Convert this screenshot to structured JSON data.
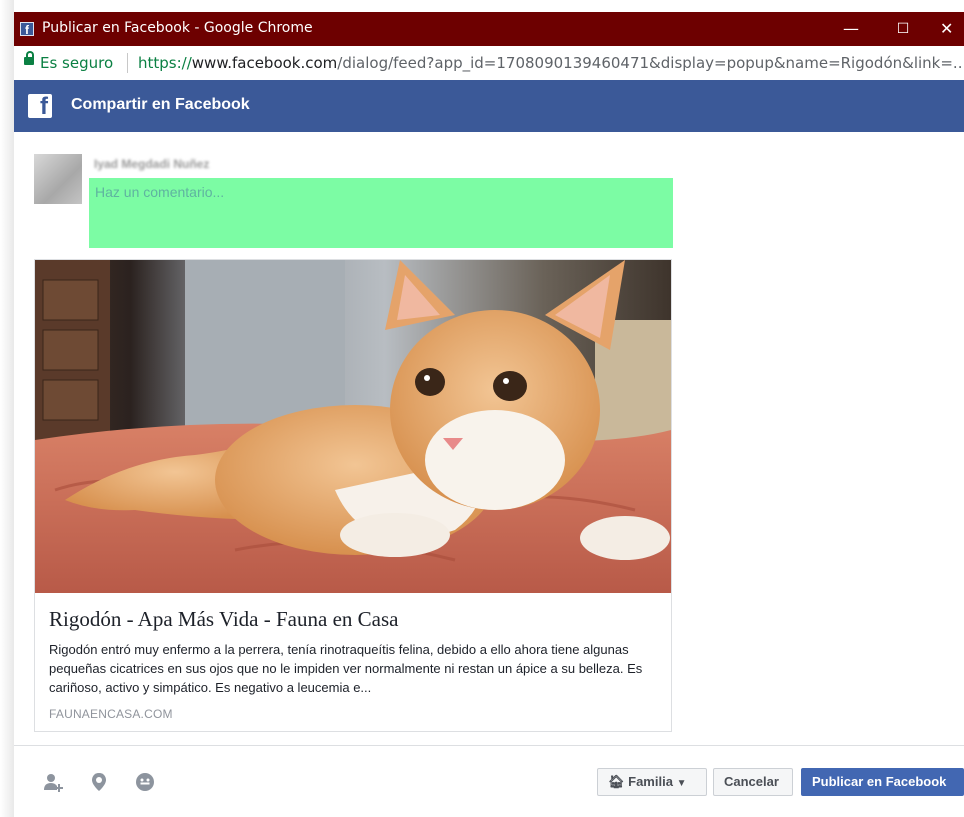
{
  "window": {
    "title": "Publicar en Facebook - Google Chrome",
    "controls": {
      "minimize": "—",
      "maximize": "☐",
      "close": "✕"
    }
  },
  "addressbar": {
    "secure_label": "Es seguro",
    "url_protocol": "https://",
    "url_host": "www.facebook.com",
    "url_path": "/dialog/feed?app_id=1708090139460471&display=popup&name=Rigodón&link=..."
  },
  "dialog": {
    "header_title": "Compartir en Facebook",
    "user_name": "Iyad Megdadi Nuñez",
    "comment_placeholder": "Haz un comentario..."
  },
  "card": {
    "title": "Rigodón - Apa Más Vida - Fauna en Casa",
    "description": "Rigodón entró muy enfermo a la perrera, tenía rinotraqueítis felina, debido a ello ahora tiene algunas pequeñas cicatrices en sus ojos que no le impiden ver normalmente ni restan un ápice a su belleza. Es cariñoso, activo y simpático. Es negativo a leucemia e...",
    "domain": "FAUNAENCASA.COM"
  },
  "footer": {
    "icons": [
      "tag-friends-icon",
      "location-icon",
      "feeling-icon"
    ],
    "audience_label": "Familia",
    "cancel_label": "Cancelar",
    "publish_label": "Publicar en Facebook"
  },
  "colors": {
    "titlebar": "#6d0000",
    "facebook_blue": "#3b5998",
    "comment_highlight": "#7cfca4",
    "publish_button": "#4267b2",
    "secure_green": "#0b8043"
  }
}
